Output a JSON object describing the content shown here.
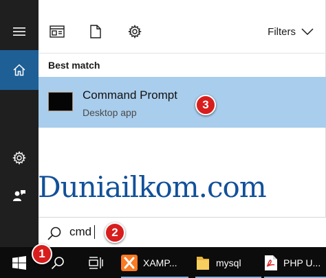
{
  "toolbar": {
    "filters_label": "Filters"
  },
  "results": {
    "section_label": "Best match",
    "best_match": {
      "title": "Command Prompt",
      "subtitle": "Desktop app"
    }
  },
  "search": {
    "value": "cmd"
  },
  "watermark": "Duniailkom.com",
  "markers": [
    "1",
    "2",
    "3"
  ],
  "taskbar": {
    "apps": [
      {
        "label": "XAMP...",
        "icon": "xampp-icon"
      },
      {
        "label": "mysql",
        "icon": "folder-icon"
      },
      {
        "label": "PHP U...",
        "icon": "pdf-icon"
      }
    ]
  },
  "colors": {
    "rail_bg": "#1f1f1f",
    "home_accent": "#1e5f95",
    "selection_bg": "#a9cdec",
    "marker_red": "#d81d1d",
    "watermark_blue": "#12509a",
    "taskbar_bg": "#0c0c0c"
  }
}
